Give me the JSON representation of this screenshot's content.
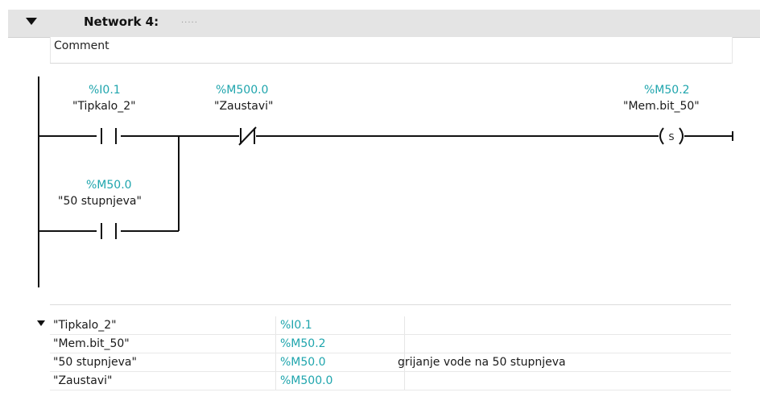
{
  "network": {
    "title": "Network 4:",
    "title_dots": ".....",
    "comment": "Comment"
  },
  "ladder": {
    "contacts": [
      {
        "address": "%I0.1",
        "symbol": "\"Tipkalo_2\"",
        "kind": "normally-open"
      },
      {
        "address": "%M500.0",
        "symbol": "\"Zaustavi\"",
        "kind": "normally-closed"
      },
      {
        "address": "%M50.0",
        "symbol": "\"50 stupnjeva\"",
        "kind": "normally-open"
      }
    ],
    "coil": {
      "address": "%M50.2",
      "symbol": "\"Mem.bit_50\"",
      "type_label": "S"
    }
  },
  "tags": [
    {
      "name": "\"Tipkalo_2\"",
      "address": "%I0.1",
      "comment": ""
    },
    {
      "name": "\"Mem.bit_50\"",
      "address": "%M50.2",
      "comment": ""
    },
    {
      "name": "\"50 stupnjeva\"",
      "address": "%M50.0",
      "comment": "grijanje vode na 50 stupnjeva"
    },
    {
      "name": "\"Zaustavi\"",
      "address": "%M500.0",
      "comment": ""
    }
  ],
  "colors": {
    "address": "#1fa5ad",
    "header_bg": "#e4e4e4",
    "wire": "#111111"
  }
}
